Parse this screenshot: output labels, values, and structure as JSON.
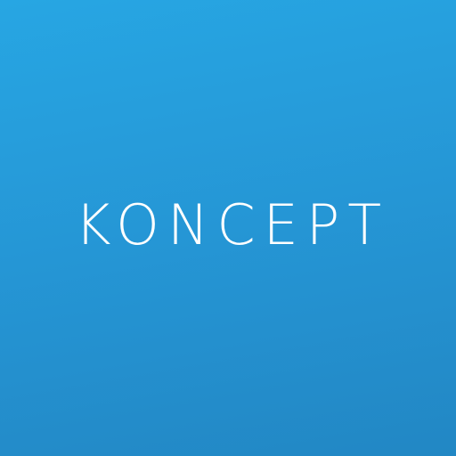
{
  "brand": {
    "name": "KONCEPT",
    "text_color": "#ffffff"
  },
  "background": {
    "gradient_start": "#27a6e3",
    "gradient_end": "#2287c4"
  }
}
